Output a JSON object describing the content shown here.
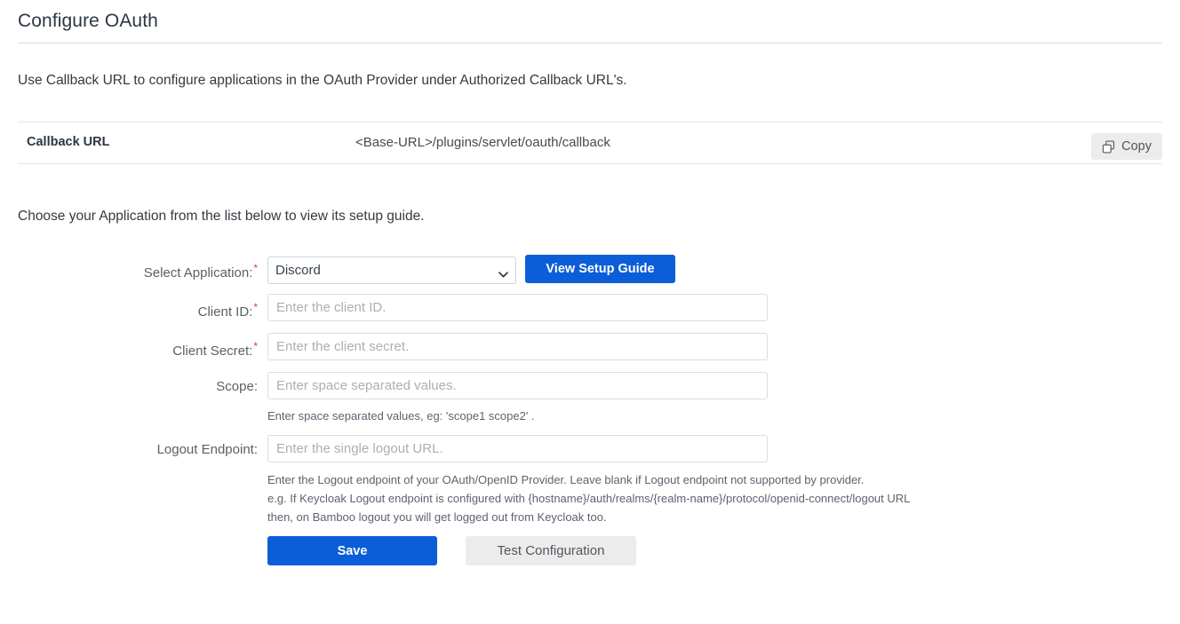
{
  "header": {
    "title": "Configure OAuth"
  },
  "intro": {
    "text": "Use Callback URL to configure applications in the OAuth Provider under Authorized Callback URL's."
  },
  "callback": {
    "label": "Callback URL",
    "value": "<Base-URL>/plugins/servlet/oauth/callback",
    "copy_label": "Copy",
    "copy_icon": "copy-icon"
  },
  "choose": {
    "text": "Choose your Application from the list below to view its setup guide."
  },
  "form": {
    "select_application": {
      "label": "Select Application:",
      "required_marker": "*",
      "selected": "Discord",
      "options": [
        "Discord"
      ],
      "chevron_icon": "chevron-down-icon"
    },
    "setup_guide_button": "View Setup Guide",
    "client_id": {
      "label": "Client ID:",
      "required_marker": "*",
      "value": "",
      "placeholder": "Enter the client ID."
    },
    "client_secret": {
      "label": "Client Secret:",
      "required_marker": "*",
      "value": "",
      "placeholder": "Enter the client secret."
    },
    "scope": {
      "label": "Scope:",
      "value": "",
      "placeholder": "Enter space separated values.",
      "hint": "Enter space separated values, eg: 'scope1 scope2' ."
    },
    "logout_endpoint": {
      "label": "Logout Endpoint:",
      "value": "",
      "placeholder": "Enter the single logout URL.",
      "hint_line1": "Enter the Logout endpoint of your OAuth/OpenID Provider. Leave blank if Logout endpoint not supported by provider.",
      "hint_line2": "e.g. If Keycloak Logout endpoint is configured with {hostname}/auth/realms/{realm-name}/protocol/openid-connect/logout URL",
      "hint_line3": "then, on Bamboo logout you will get logged out from Keycloak too."
    },
    "save_button": "Save",
    "test_button": "Test Configuration"
  },
  "colors": {
    "primary": "#0b5ed7",
    "required": "#d04437",
    "text": "#343a40",
    "muted": "#5a6066",
    "button_secondary_bg": "#ececec"
  }
}
